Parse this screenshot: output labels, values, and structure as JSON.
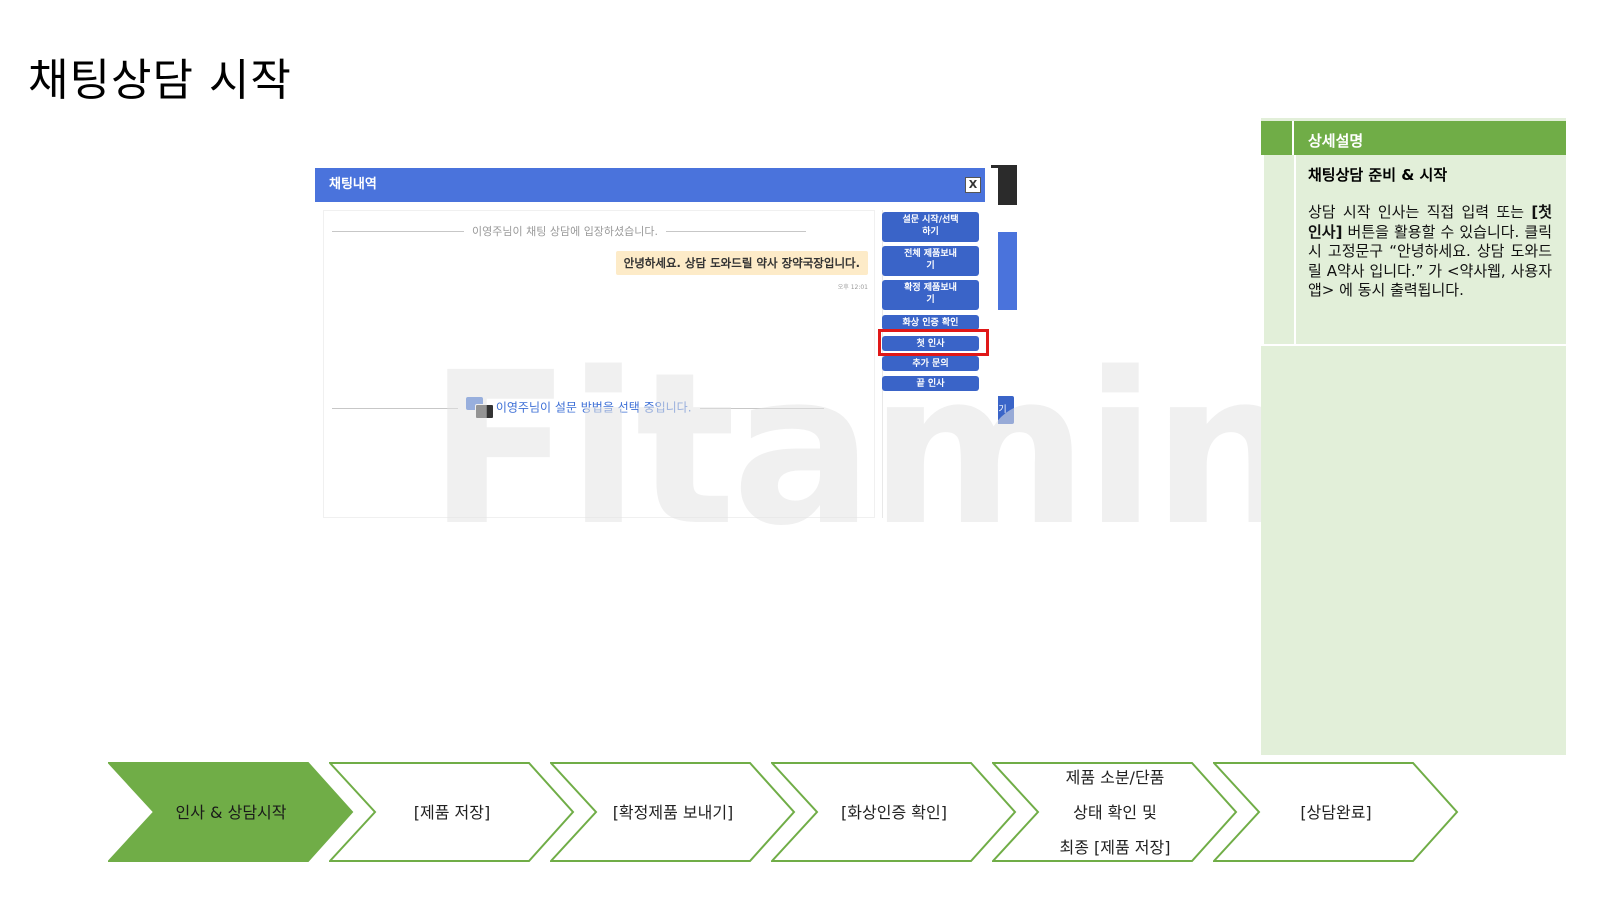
{
  "page": {
    "title": "채팅상담 시작"
  },
  "chat_window": {
    "title": "채팅내역",
    "close_label": "X",
    "system_enter": "이영주님이 채팅 상담에 입장하셨습니다.",
    "greeting_bubble": "안녕하세요. 상담 도와드릴 약사 장약국장입니다.",
    "bubble_time": "오후 12:01",
    "system_survey": "이영주님이 설문 방법을 선택 중입니다.",
    "watermark": "Fitamin",
    "side_fragment": "기",
    "quick_buttons": [
      {
        "label": "설문 시작/선택\n하기"
      },
      {
        "label": "전체 제품보내\n기"
      },
      {
        "label": "확정 제품보내\n기"
      },
      {
        "label": "화상 인증 확인"
      },
      {
        "label": "첫 인사"
      },
      {
        "label": "추가 문의"
      },
      {
        "label": "끝 인사"
      }
    ],
    "highlighted_button": "첫 인사",
    "colors": {
      "header": "#4a73dc",
      "button": "#3a64c8",
      "bubble": "#fdebc8",
      "highlight": "#e01818"
    }
  },
  "detail_panel": {
    "header": "상세설명",
    "subtitle": "채팅상담 준비 & 시작",
    "body_before": "상담 시작 인사는 직접 입력 또는 ",
    "body_bold": "[첫 인사]",
    "body_after": " 버튼을 활용할 수 있습니다. 클릭 시 고정문구 “안녕하세요. 상담 도와드릴 A약사 입니다.” 가 <약사웹, 사용자 앱> 에 동시 출력됩니다.",
    "colors": {
      "header": "#70ad47",
      "background": "#e2efd9"
    }
  },
  "process_flow": {
    "steps": [
      {
        "label": "인사 & 상담시작",
        "active": true
      },
      {
        "label": "[제품 저장]",
        "active": false
      },
      {
        "label": "[확정제품 보내기]",
        "active": false
      },
      {
        "label": "[화상인증 확인]",
        "active": false
      },
      {
        "label": "제품 소분/단품\n상태 확인 및\n최종 [제품 저장]",
        "active": false
      },
      {
        "label": "[상담완료]",
        "active": false
      }
    ],
    "colors": {
      "active_fill": "#70ad47",
      "outline": "#70ad47"
    }
  }
}
